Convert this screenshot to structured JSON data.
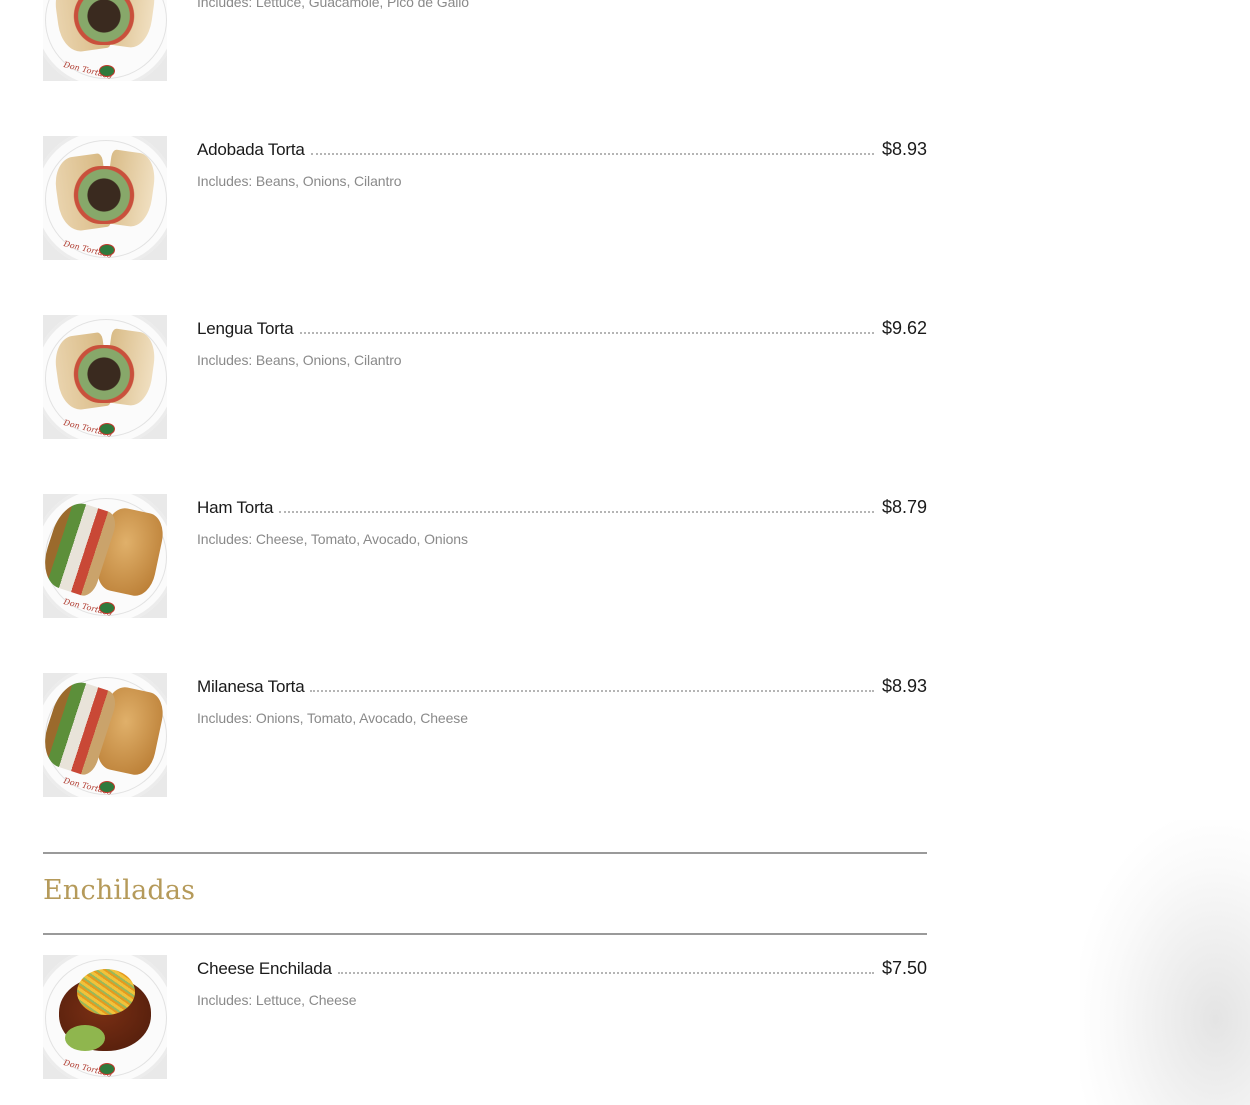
{
  "partial_top_item": {
    "description": "Includes: Lettuce, Guacamole, Pico de Gallo"
  },
  "tortas": [
    {
      "name": "Adobada Torta",
      "price": "$8.93",
      "description": "Includes: Beans, Onions, Cilantro",
      "photo": "torta-cross-section"
    },
    {
      "name": "Lengua Torta",
      "price": "$9.62",
      "description": "Includes: Beans, Onions, Cilantro",
      "photo": "torta-cross-section"
    },
    {
      "name": "Ham Torta",
      "price": "$8.79",
      "description": "Includes: Cheese, Tomato, Avocado, Onions",
      "photo": "ham-sandwich"
    },
    {
      "name": "Milanesa Torta",
      "price": "$8.93",
      "description": "Includes: Onions, Tomato, Avocado, Cheese",
      "photo": "ham-sandwich"
    }
  ],
  "enchiladas_section": {
    "title": "Enchiladas",
    "items": [
      {
        "name": "Cheese Enchilada",
        "price": "$7.50",
        "description": "Includes: Lettuce, Cheese",
        "photo": "enchilada-plate"
      }
    ]
  },
  "colors": {
    "section_title": "#b59a5a",
    "rule": "#9a9a9a",
    "description_text": "#8a8a8a"
  }
}
